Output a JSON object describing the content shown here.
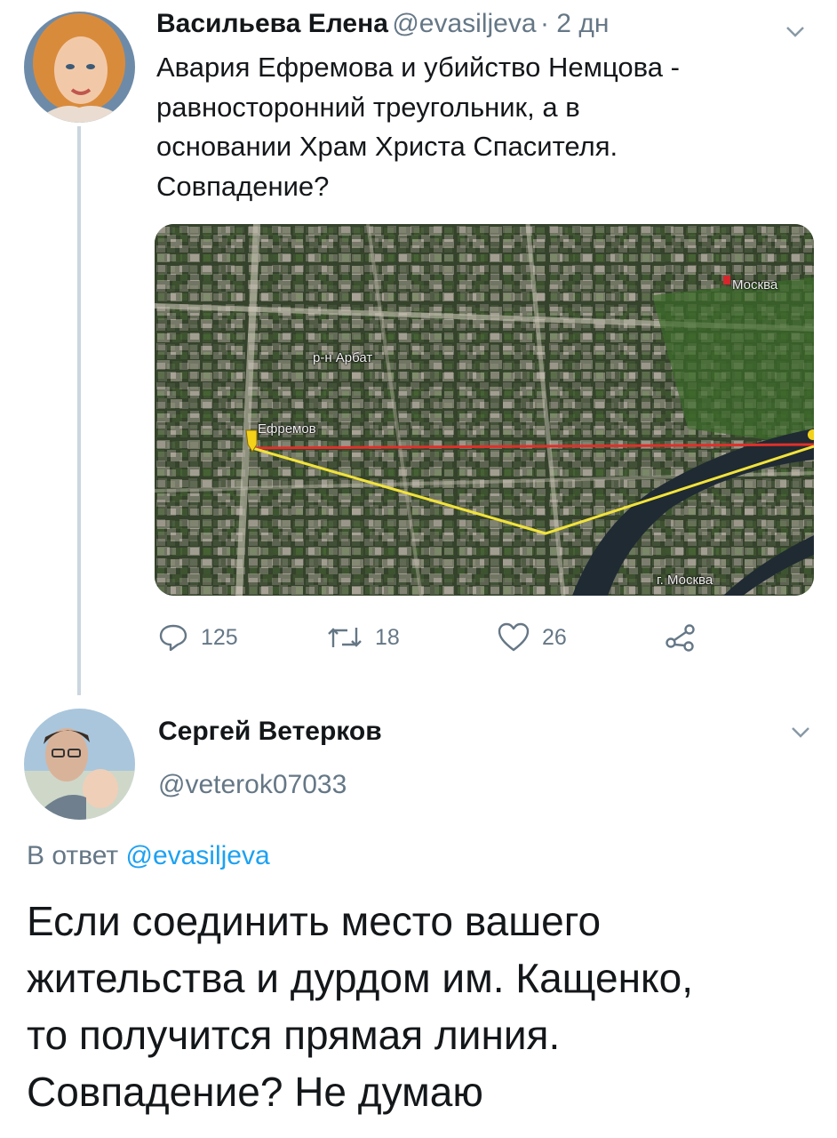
{
  "tweet1": {
    "name": "Васильева Елена",
    "handle": "@evasiljeva",
    "time": "· 2 дн",
    "lines": [
      "Авария Ефремова и убийство Немцова -",
      "равносторонний треугольник, а в",
      "основании Храм Христа Спасителя.",
      "Совпадение?"
    ],
    "map_labels": {
      "moscow_top": "Москва",
      "arbat": "р-н Арбат",
      "efremov": "Ефремов",
      "moscow_bottom": "г. Москва"
    },
    "actions": {
      "replies": "125",
      "retweets": "18",
      "likes": "26"
    }
  },
  "tweet2": {
    "name": "Сергей Ветерков",
    "handle": "@veterok07033",
    "reply_prefix": "В ответ",
    "reply_to": "@evasiljeva",
    "lines": [
      "Если соединить место вашего",
      "жительства и дурдом им. Кащенко,",
      "то получится прямая линия.",
      "Совпадение? Не думаю"
    ]
  },
  "colors": {
    "link": "#1da1f2",
    "muted": "#657786",
    "thread_line": "#cbd6df",
    "map_red_line": "#e0302a",
    "map_yellow_line": "#f2e33a"
  }
}
